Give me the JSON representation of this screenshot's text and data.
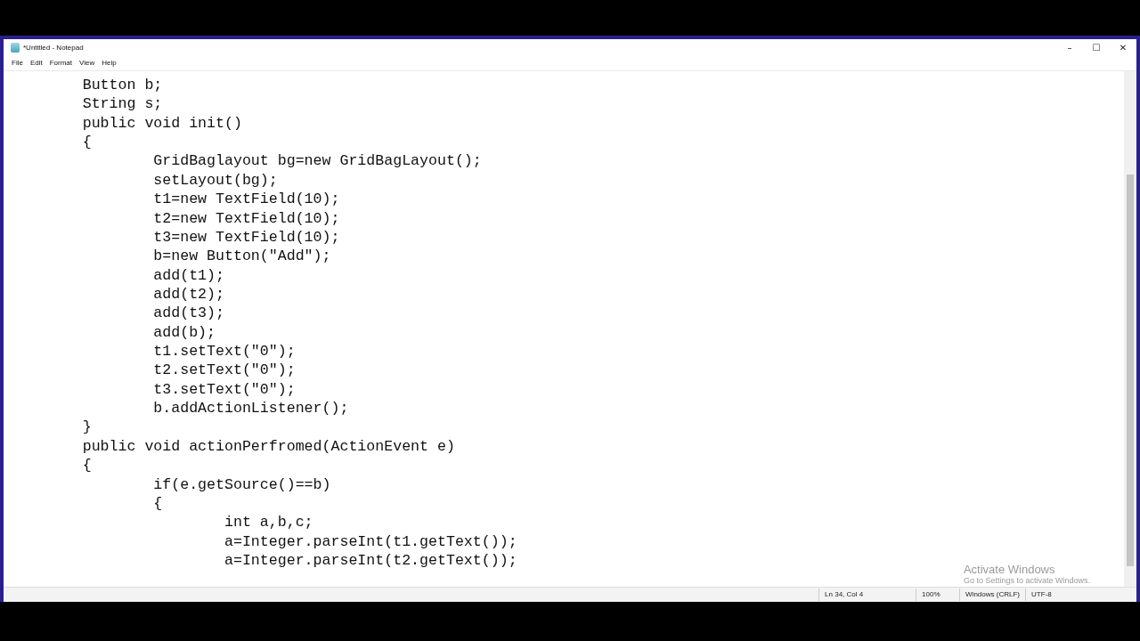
{
  "window": {
    "title": "*Untitled - Notepad",
    "controls": [
      "–",
      "☐",
      "✕"
    ]
  },
  "menu": [
    "File",
    "Edit",
    "Format",
    "View",
    "Help"
  ],
  "lines": [
    "\tButton b;",
    "\tString s;",
    "\tpublic void init()",
    "\t{",
    "\t\tGridBaglayout bg=new GridBagLayout();",
    "\t\tsetLayout(bg);",
    "\t\tt1=new TextField(10);",
    "\t\tt2=new TextField(10);",
    "\t\tt3=new TextField(10);",
    "\t\tb=new Button(\"Add\");",
    "\t\tadd(t1);",
    "\t\tadd(t2);",
    "\t\tadd(t3);",
    "\t\tadd(b);",
    "\t\tt1.setText(\"0\");",
    "\t\tt2.setText(\"0\");",
    "\t\tt3.setText(\"0\");",
    "\t\tb.addActionListener();",
    "\t}",
    "\tpublic void actionPerfromed(ActionEvent e)",
    "\t{",
    "\t\tif(e.getSource()==b)",
    "\t\t{",
    "\t\t\tint a,b,c;",
    "\t\t\ta=Integer.parseInt(t1.getText());",
    "\t\t\ta=Integer.parseInt(t2.getText());"
  ],
  "activation": {
    "title": "Activate Windows",
    "subtitle": "Go to Settings to activate Windows."
  },
  "status_bar": [
    "Ln 34, Col 4",
    "100%",
    "Windows (CRLF)",
    "UTF-8"
  ]
}
